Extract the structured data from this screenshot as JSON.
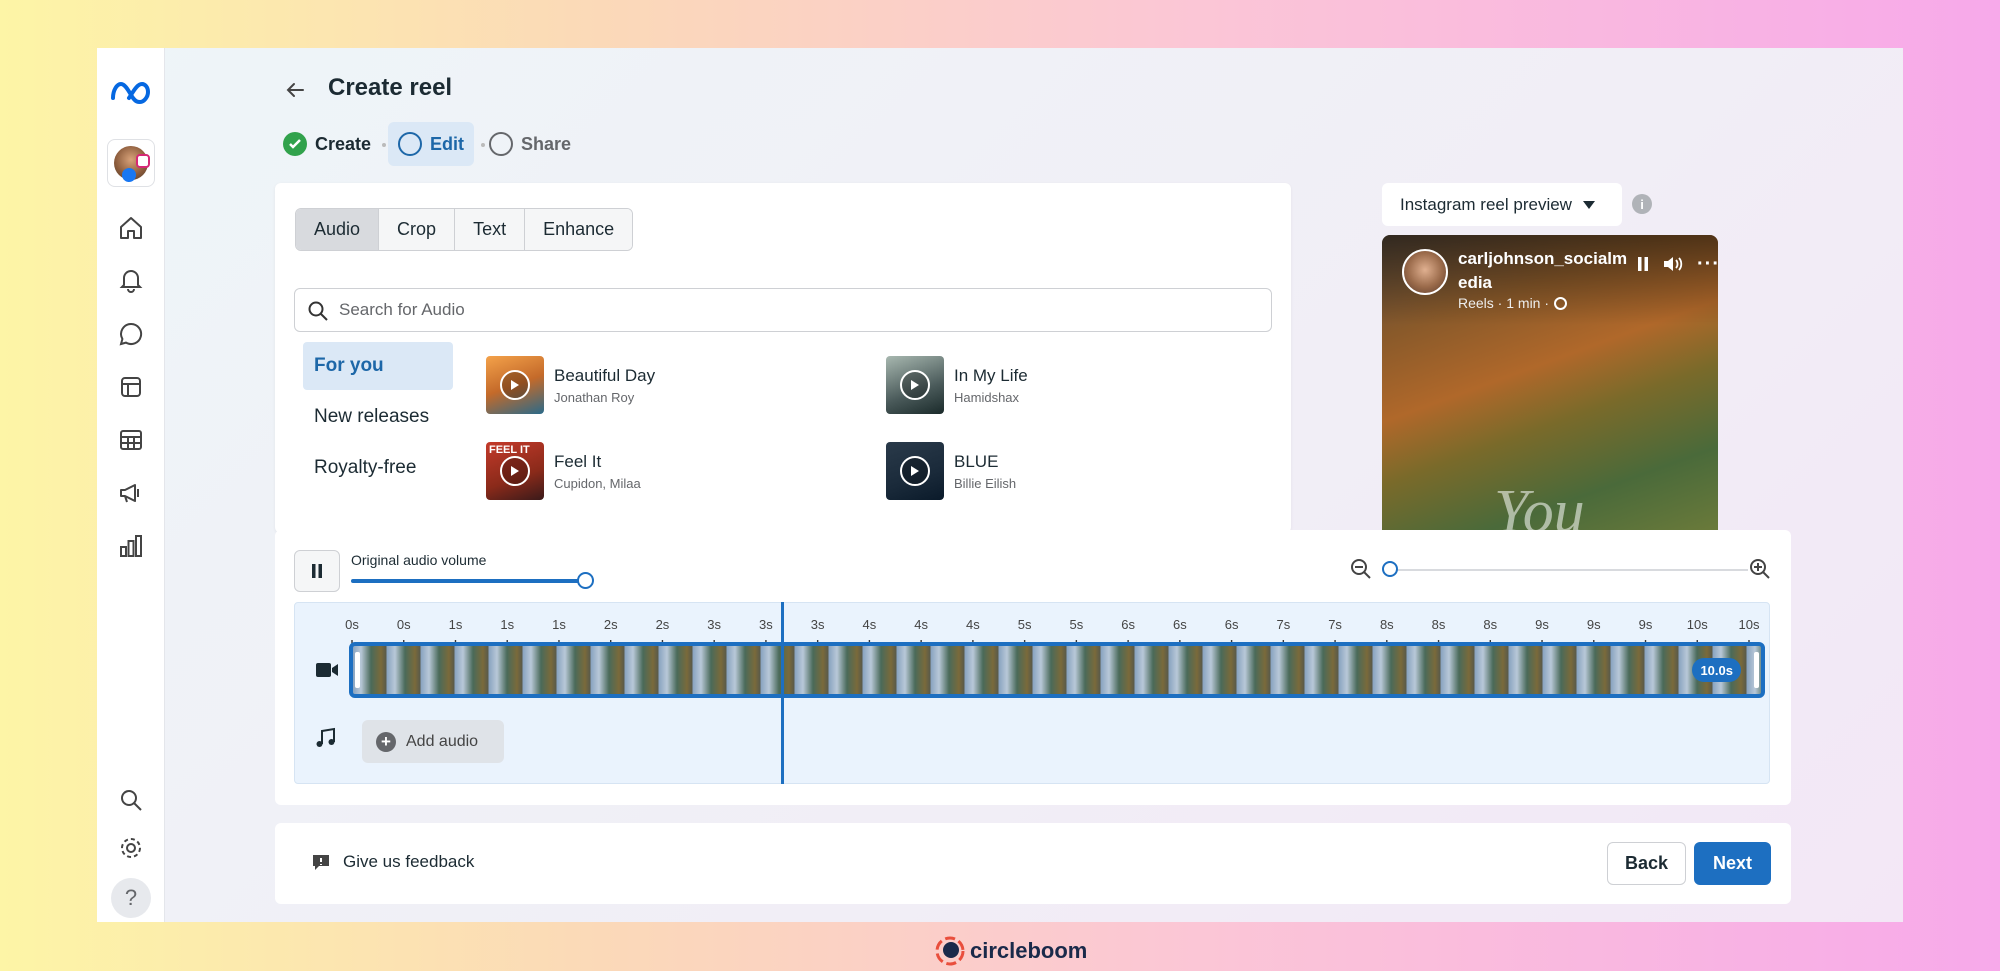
{
  "page": {
    "title": "Create reel"
  },
  "steps": [
    {
      "label": "Create",
      "state": "done"
    },
    {
      "label": "Edit",
      "state": "active"
    },
    {
      "label": "Share",
      "state": "pending"
    }
  ],
  "tabs": [
    "Audio",
    "Crop",
    "Text",
    "Enhance"
  ],
  "active_tab": "Audio",
  "search": {
    "placeholder": "Search for Audio"
  },
  "categories": [
    "For you",
    "New releases",
    "Royalty-free"
  ],
  "active_category": "For you",
  "tracks": [
    {
      "name": "Beautiful Day",
      "artist": "Jonathan Roy"
    },
    {
      "name": "In My Life",
      "artist": "Hamidshax"
    },
    {
      "name": "Feel It",
      "artist": "Cupidon, Milaa"
    },
    {
      "name": "BLUE",
      "artist": "Billie Eilish"
    }
  ],
  "preview": {
    "dropdown_label": "Instagram reel preview",
    "username_line1": "carljohnson_socialm",
    "username_line2": "edia",
    "meta": "Reels · 1 min ·",
    "overlay_text": "You",
    "thumb_text": "FEEL IT"
  },
  "timeline": {
    "volume_label": "Original audio volume",
    "volume_level": 1.0,
    "zoom_level": 0.0,
    "playhead_seconds": 3,
    "clip_duration": "10.0s",
    "add_audio_label": "Add audio",
    "tick_labels": [
      "0s",
      "0s",
      "1s",
      "1s",
      "1s",
      "2s",
      "2s",
      "3s",
      "3s",
      "3s",
      "4s",
      "4s",
      "4s",
      "5s",
      "5s",
      "6s",
      "6s",
      "6s",
      "7s",
      "7s",
      "8s",
      "8s",
      "8s",
      "9s",
      "9s",
      "9s",
      "10s",
      "10s"
    ]
  },
  "footer": {
    "feedback_label": "Give us feedback",
    "back_label": "Back",
    "next_label": "Next"
  },
  "watermark": "circleboom",
  "colors": {
    "accent": "#1877f2",
    "primary_button": "#1d6fc1",
    "success": "#31a24c",
    "active_step_bg": "#dbe8f6"
  }
}
